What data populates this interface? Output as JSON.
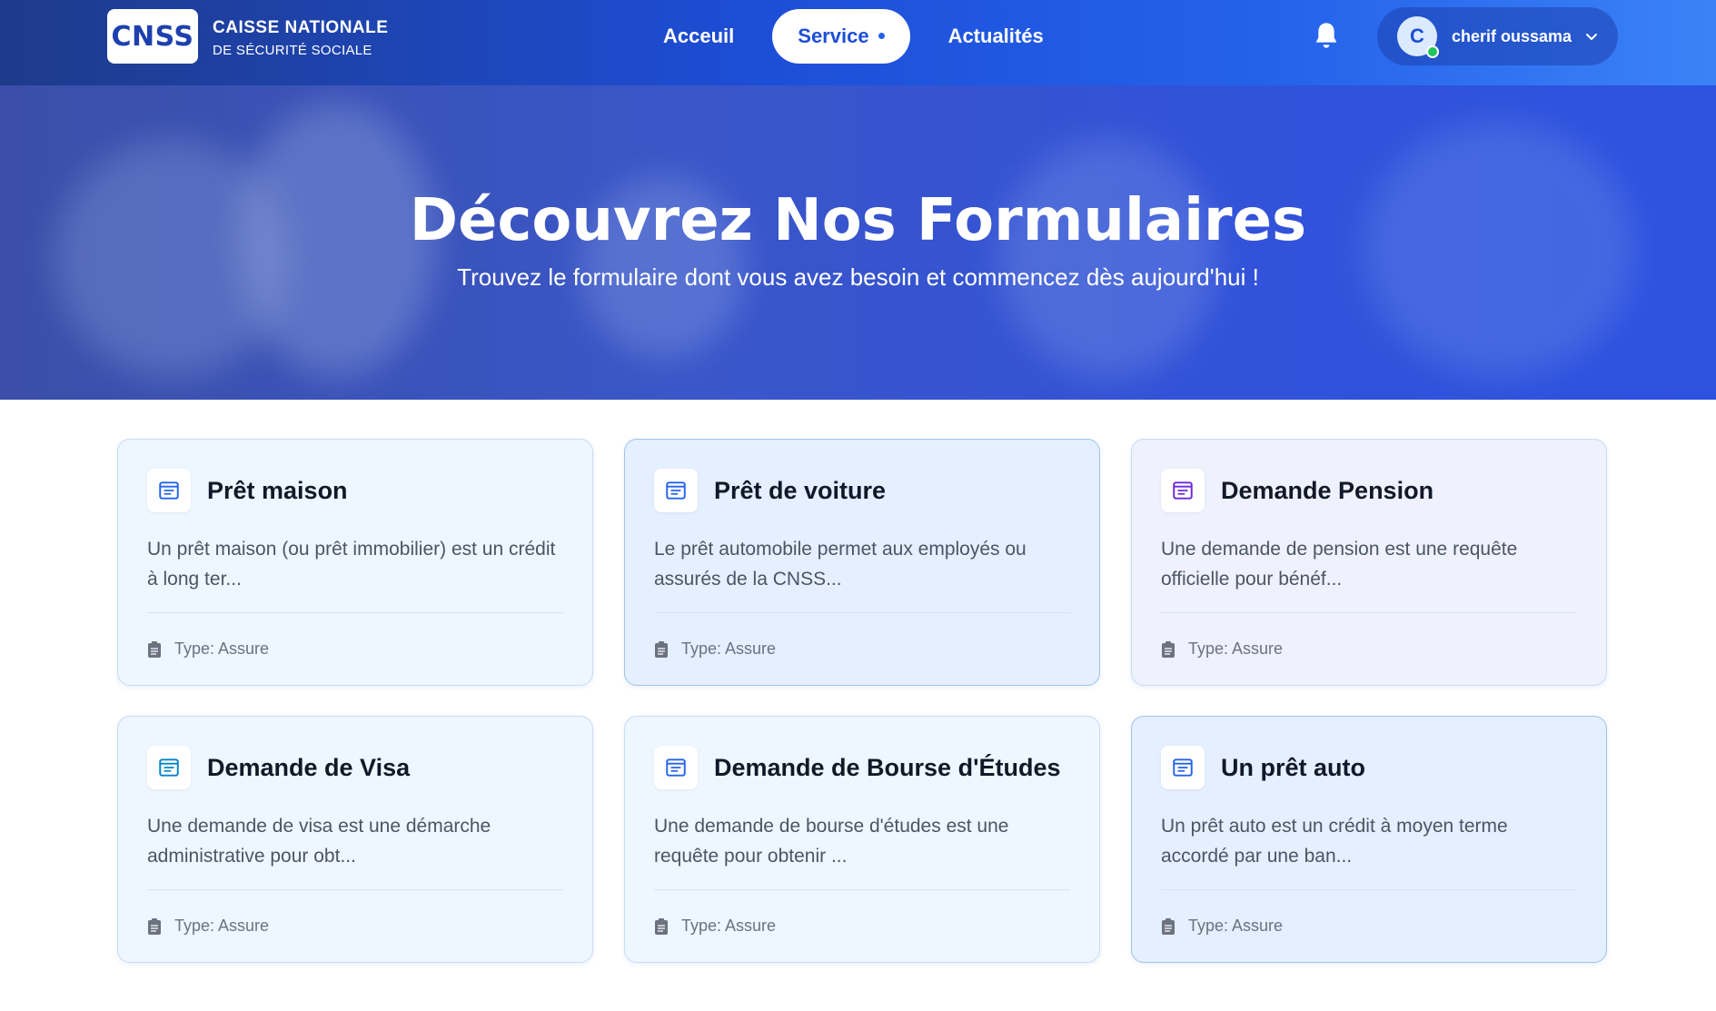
{
  "header": {
    "logo": "CNSS",
    "org_line1": "CAISSE NATIONALE",
    "org_line2": "DE SÉCURITÉ SOCIALE",
    "nav": [
      {
        "label": "Acceuil"
      },
      {
        "label": "Service",
        "active": true
      },
      {
        "label": "Actualités"
      }
    ],
    "bell_icon": "bell-icon",
    "user": {
      "initial": "C",
      "name": "cherif oussama",
      "status": "online"
    },
    "colors": {
      "header_start": "#1e3a8a",
      "header_end": "#3b82f6",
      "accent": "#1d4ed8"
    }
  },
  "hero": {
    "title": "Découvrez Nos Formulaires",
    "subtitle": "Trouvez le formulaire dont vous avez besoin et commencez dès aujourd'hui !"
  },
  "cards": [
    {
      "title": "Prêt maison",
      "description": "Un prêt maison (ou prêt immobilier) est un crédit à long ter...",
      "type": "Type: Assure"
    },
    {
      "title": "Prêt de voiture",
      "description": "Le prêt automobile permet aux employés ou assurés de la CNSS...",
      "type": "Type: Assure"
    },
    {
      "title": "Demande Pension",
      "description": "Une demande de pension est une requête officielle pour bénéf...",
      "type": "Type: Assure"
    },
    {
      "title": "Demande de Visa",
      "description": "Une demande de visa est une démarche administrative pour obt...",
      "type": "Type: Assure"
    },
    {
      "title": "Demande de Bourse d'Études",
      "description": "Une demande de bourse d'études est une requête pour obtenir ...",
      "type": "Type: Assure"
    },
    {
      "title": "Un prêt auto",
      "description": "Un prêt auto est un crédit à moyen terme accordé par une ban...",
      "type": "Type: Assure"
    }
  ]
}
